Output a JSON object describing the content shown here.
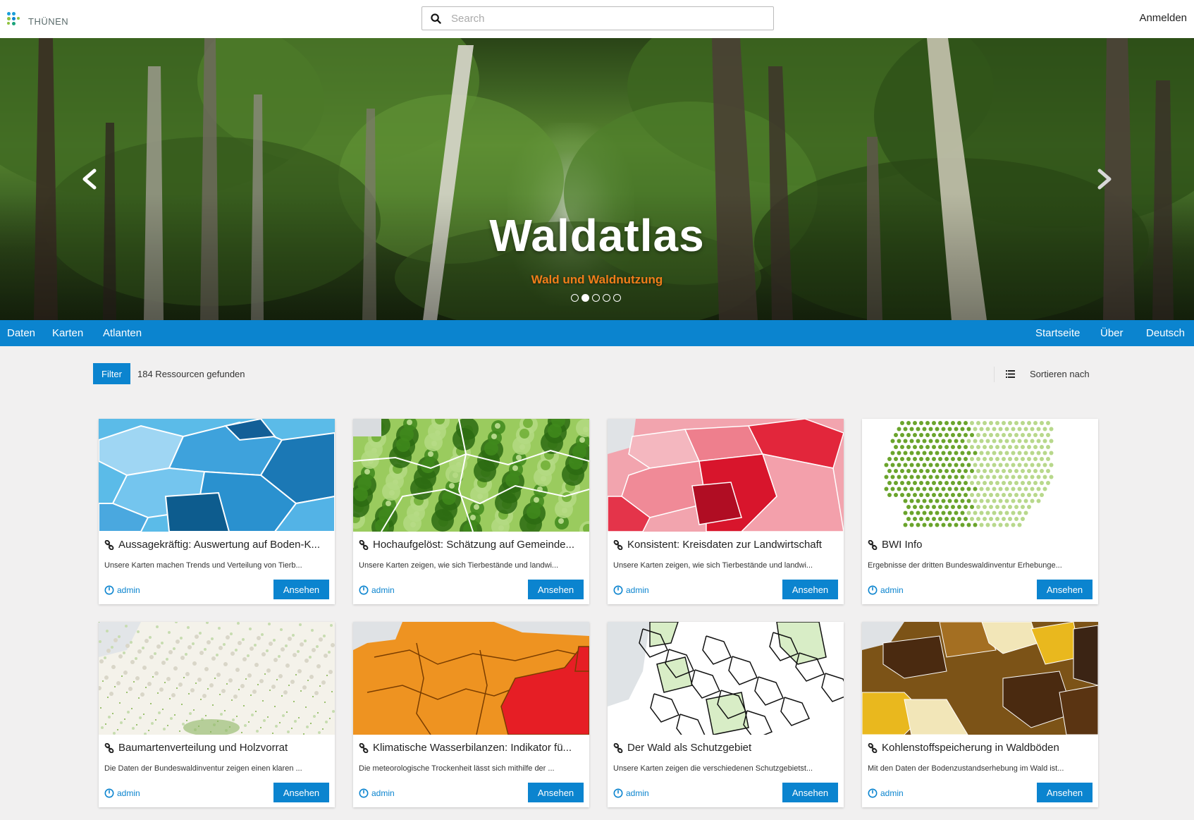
{
  "header": {
    "logo_text": "THÜNEN",
    "search_placeholder": "Search",
    "login_label": "Anmelden"
  },
  "hero": {
    "title": "Waldatlas",
    "subtitle": "Wald und Waldnutzung",
    "slide_count": 5,
    "active_slide": 2
  },
  "nav": {
    "left": [
      "Daten",
      "Karten",
      "Atlanten"
    ],
    "right": [
      "Startseite",
      "Über",
      "Deutsch"
    ]
  },
  "toolbar": {
    "filter_label": "Filter",
    "result_count": "184 Ressourcen gefunden",
    "sort_label": "Sortieren nach"
  },
  "cards": [
    {
      "title": "Aussagekräftig: Auswertung auf Boden-K...",
      "description": "Unsere Karten machen Trends und Verteilung von Tierb...",
      "owner": "admin",
      "button": "Ansehen",
      "thumb": "blue-map"
    },
    {
      "title": "Hochaufgelöst: Schätzung auf Gemeinde...",
      "description": "Unsere Karten zeigen, wie sich Tierbestände und landwi...",
      "owner": "admin",
      "button": "Ansehen",
      "thumb": "green-map"
    },
    {
      "title": "Konsistent: Kreisdaten zur Landwirtschaft",
      "description": "Unsere Karten zeigen, wie sich Tierbestände und landwi...",
      "owner": "admin",
      "button": "Ansehen",
      "thumb": "red-map"
    },
    {
      "title": "BWI Info",
      "description": "Ergebnisse der dritten Bundeswaldinventur Erhebunge...",
      "owner": "admin",
      "button": "Ansehen",
      "thumb": "dot-map"
    },
    {
      "title": "Baumartenverteilung und Holzvorrat",
      "description": "Die Daten der Bundeswaldinventur zeigen einen klaren ...",
      "owner": "admin",
      "button": "Ansehen",
      "thumb": "sparse-green-map"
    },
    {
      "title": "Klimatische Wasserbilanzen: Indikator fü...",
      "description": "Die meteorologische Trockenheit lässt sich mithilfe der ...",
      "owner": "admin",
      "button": "Ansehen",
      "thumb": "orange-map"
    },
    {
      "title": "Der Wald als Schutzgebiet",
      "description": "Unsere Karten zeigen die verschiedenen Schutzgebietst...",
      "owner": "admin",
      "button": "Ansehen",
      "thumb": "white-map"
    },
    {
      "title": "Kohlenstoffspeicherung in Waldböden",
      "description": "Mit den Daten der Bodenzustandserhebung im Wald ist...",
      "owner": "admin",
      "button": "Ansehen",
      "thumb": "brown-map"
    }
  ],
  "colors": {
    "primary": "#0b84cf",
    "accent": "#f07d1a",
    "background": "#f1f0f0"
  }
}
